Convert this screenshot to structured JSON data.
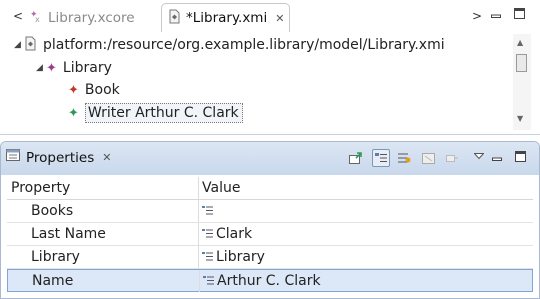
{
  "editor": {
    "tabs": [
      {
        "label": "Library.xcore",
        "active": false
      },
      {
        "label": "*Library.xmi",
        "active": true
      }
    ],
    "tree": {
      "root": "platform:/resource/org.example.library/model/Library.xmi",
      "library": "Library",
      "book": "Book",
      "writer": "Writer Arthur C. Clark"
    }
  },
  "properties": {
    "title": "Properties",
    "columns": [
      "Property",
      "Value"
    ],
    "rows": [
      {
        "property": "Books",
        "value": ""
      },
      {
        "property": "Last Name",
        "value": "Clark"
      },
      {
        "property": "Library",
        "value": "Library"
      },
      {
        "property": "Name",
        "value": "Arthur C. Clark"
      }
    ],
    "selected_row": "Name"
  },
  "colors": {
    "panel_header": "#c9d8ec",
    "selection": "#dce8f7",
    "accent_green": "#2e9a57",
    "accent_purple": "#9c3b8f"
  }
}
